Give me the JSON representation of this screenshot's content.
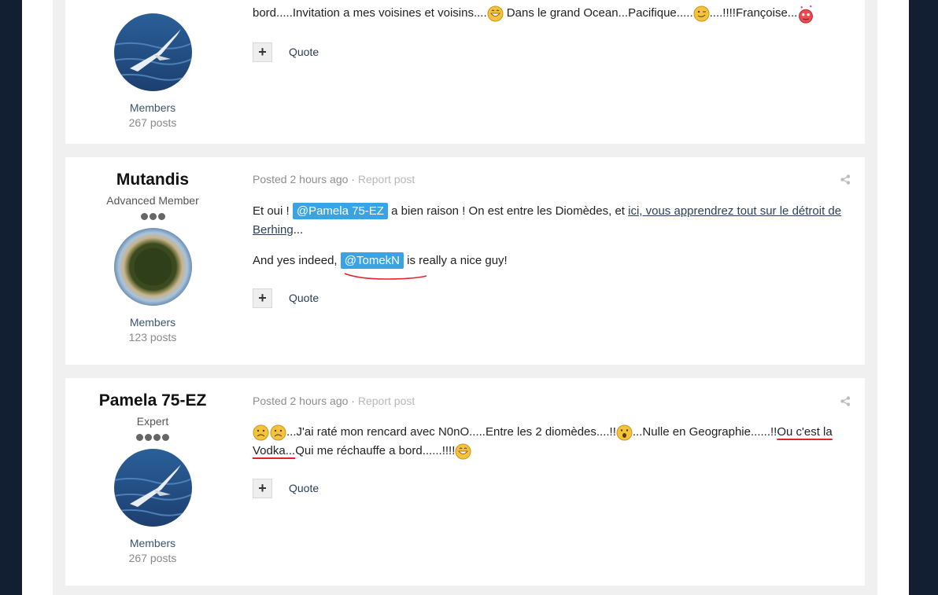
{
  "posts": [
    {
      "group": "Members",
      "posts_count": "267 posts",
      "body_fragments": {
        "a": "bord.....Invitation a mes voisines et voisins....",
        "b": " Dans le grand Ocean...Pacifique.....",
        "c": "....!!!!Françoise..."
      },
      "actions": {
        "quote": "Quote"
      }
    },
    {
      "author": "Mutandis",
      "title": "Advanced Member",
      "group": "Members",
      "posts_count": "123 posts",
      "posted": "Posted 2 hours ago",
      "separator": " · ",
      "report": "Report post",
      "p1": {
        "a": "Et oui ! ",
        "mention": "@Pamela 75-EZ",
        "b": " a bien raison ! On est entre les Diomèdes, et ",
        "link": "ici, vous apprendrez tout sur le détroit de Berhing",
        "c": "..."
      },
      "p2": {
        "a": "And yes indeed, ",
        "mention": "@TomekN",
        "b": " is really a nice guy!"
      },
      "actions": {
        "quote": "Quote"
      }
    },
    {
      "author": "Pamela 75-EZ",
      "title": "Expert",
      "group": "Members",
      "posts_count": "267 posts",
      "posted": "Posted 2 hours ago",
      "separator": " · ",
      "report": "Report post",
      "body": {
        "a": "...J'ai raté mon rencard avec N0nO.....Entre les 2 diomèdes....!!",
        "b": "...Nulle en Geographie......!!",
        "c": "Ou c'est la Vodka...",
        "d": "Qui me réchauffe a bord......!!!!"
      },
      "actions": {
        "quote": "Quote"
      }
    }
  ],
  "colors": {
    "outer_background": "#121f33",
    "mention_background": "#3aa3e3",
    "link": "#2b3f58",
    "annotation_red": "#e2242a"
  },
  "icons": [
    "share-icon",
    "plus-icon",
    "grin-emoji",
    "wink-emoji",
    "love-emoji",
    "sad-emoji",
    "surprised-emoji"
  ]
}
